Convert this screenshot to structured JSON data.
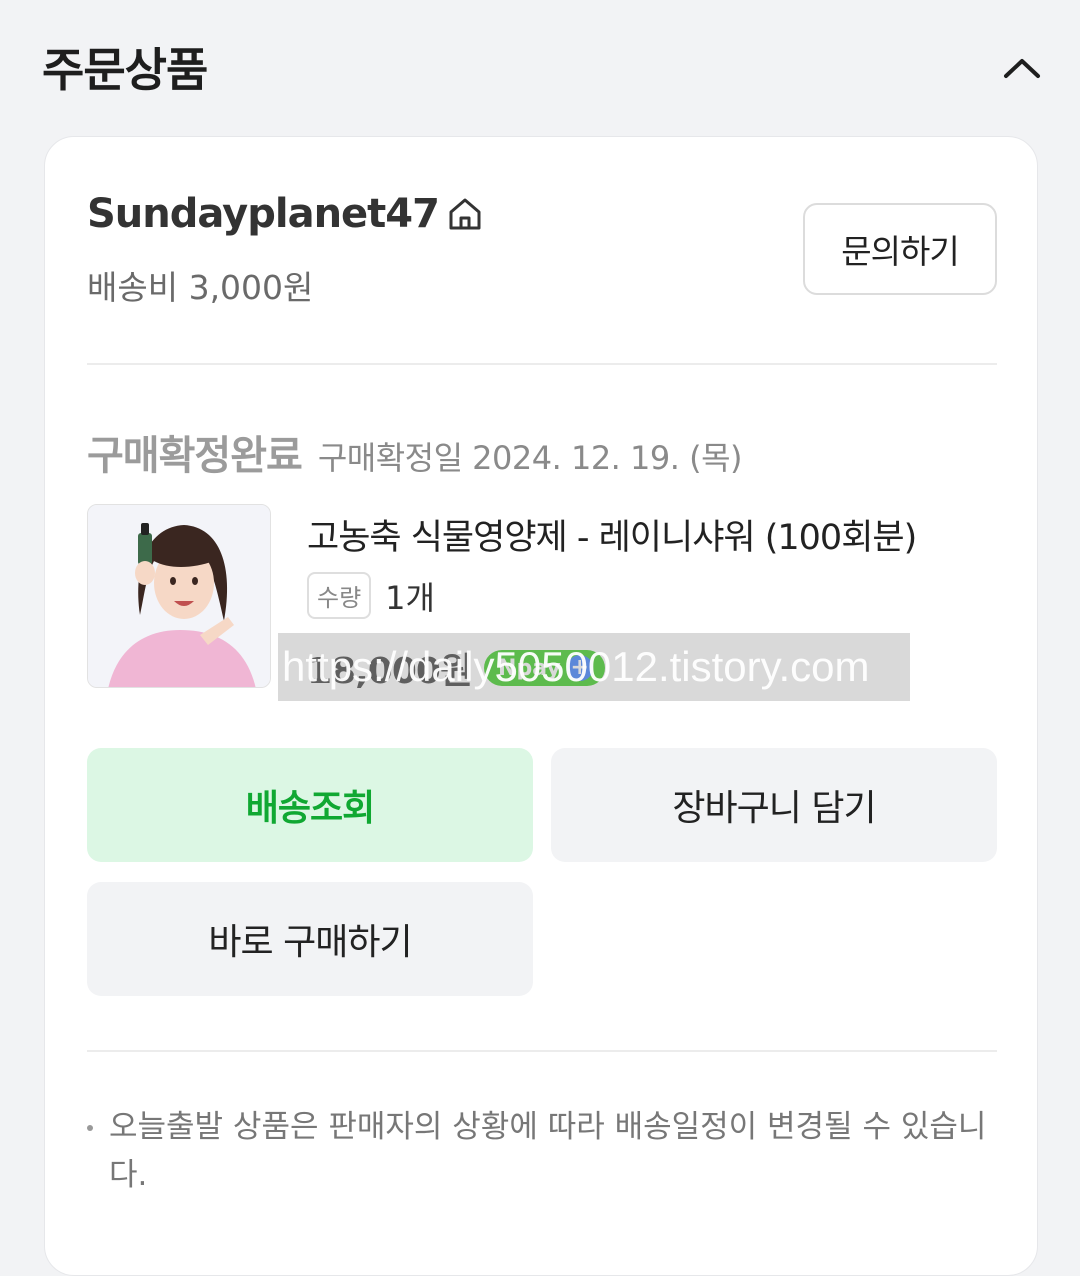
{
  "section": {
    "title": "주문상품"
  },
  "seller": {
    "name": "Sundayplanet47",
    "shipping_fee": "배송비 3,000원",
    "inquiry_label": "문의하기"
  },
  "order": {
    "status": "구매확정완료",
    "confirm_date": "구매확정일 2024. 12. 19. (목)"
  },
  "product": {
    "name": "고농축 식물영양제 - 레이니샤워 (100회분)",
    "qty_label": "수량",
    "qty_value": "1개",
    "price": "18,000원",
    "npay_label": "Npay"
  },
  "watermark": "https://daily5050012.tistory.com",
  "actions": {
    "track_delivery": "배송조회",
    "add_to_cart": "장바구니 담기",
    "buy_now": "바로 구매하기"
  },
  "notice": "오늘출발 상품은 판매자의 상황에 따라 배송일정이 변경될 수 있습니다.",
  "colors": {
    "page_bg": "#f2f3f5",
    "card_bg": "#ffffff",
    "primary_button_bg": "#dcf7e4",
    "primary_button_text": "#10a832",
    "npay_green": "#1ec800"
  }
}
